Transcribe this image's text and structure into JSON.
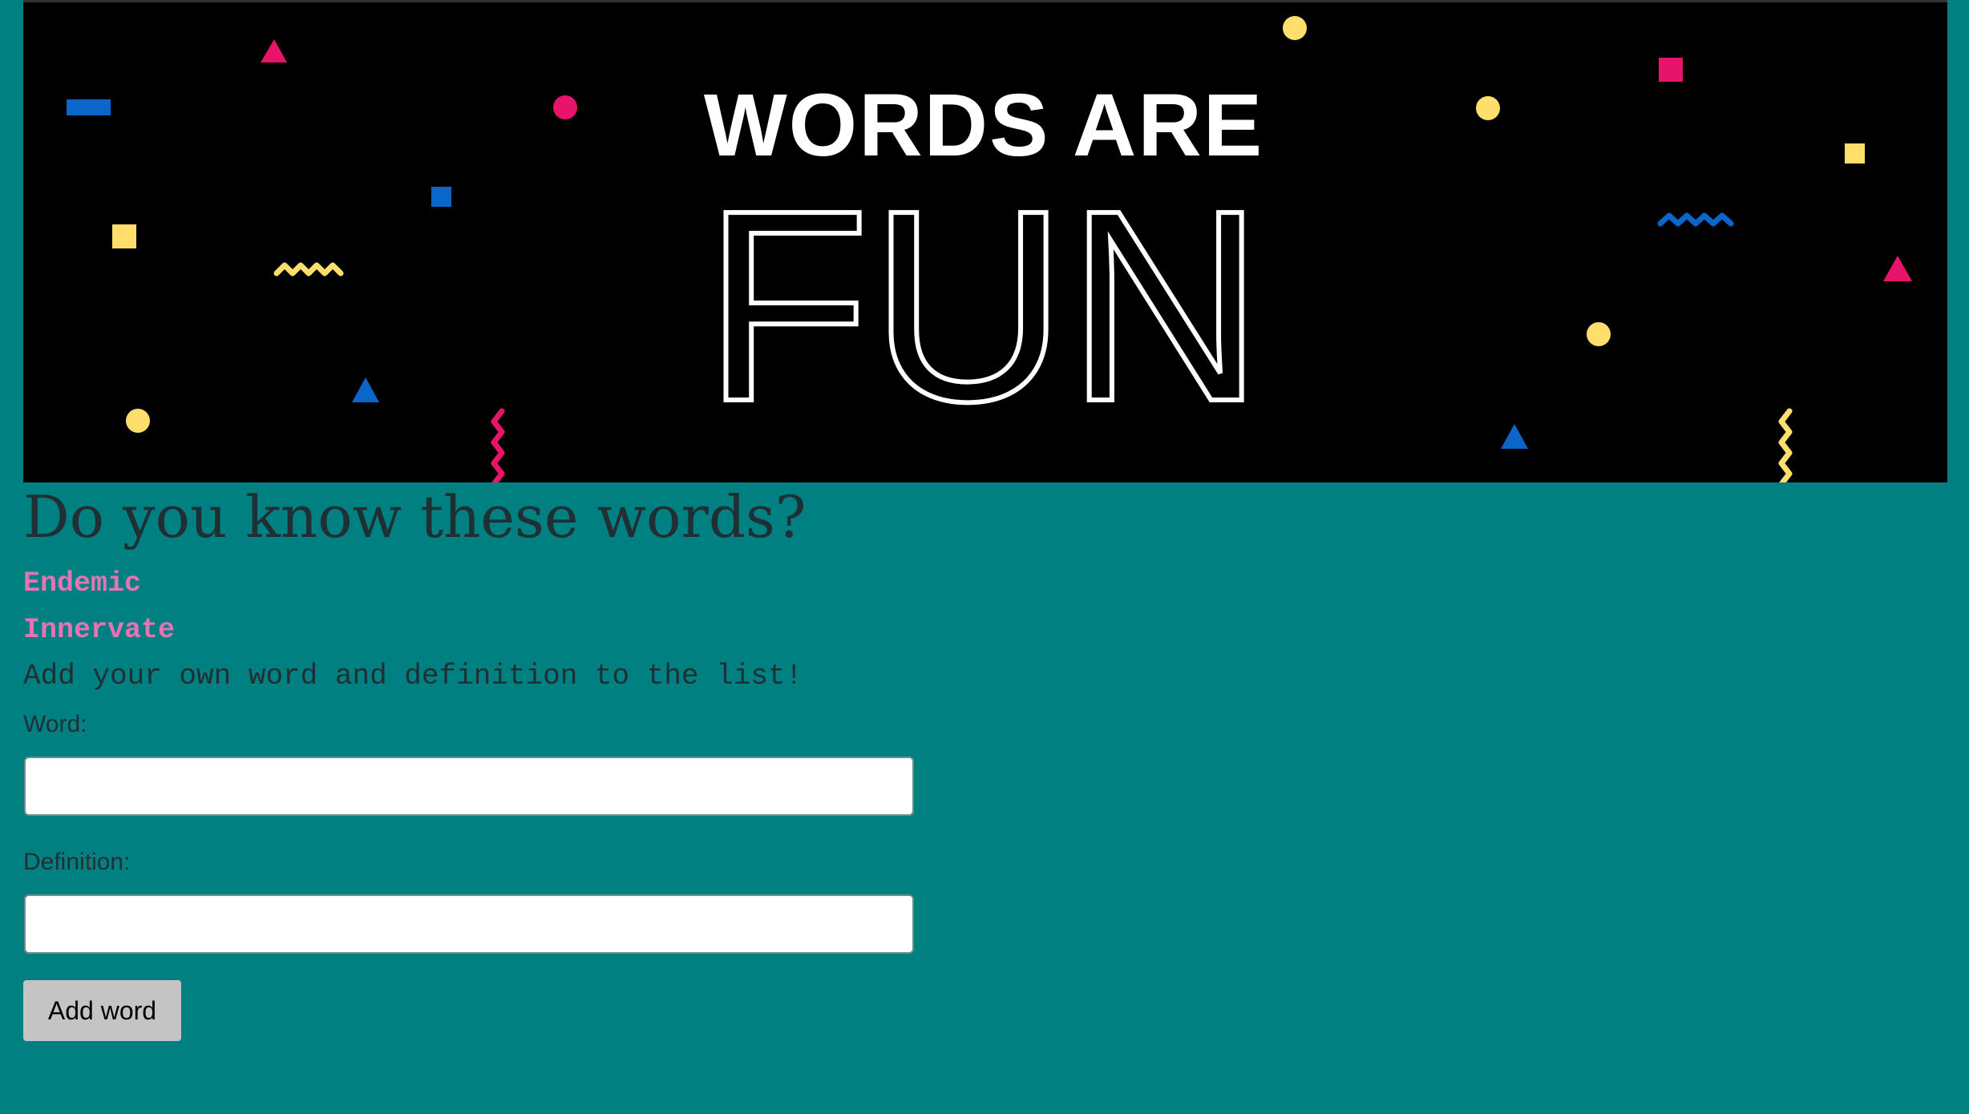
{
  "banner": {
    "line1": "WORDS ARE",
    "line2": "FUN",
    "colors": {
      "background": "#000000",
      "text": "#ffffff",
      "pink": "#e8146c",
      "blue": "#0a66c8",
      "yellow": "#ffde6b"
    }
  },
  "main": {
    "heading": "Do you know these words?",
    "words": [
      "Endemic",
      "Innervate"
    ],
    "prompt": "Add your own word and definition to the list!"
  },
  "form": {
    "word_label": "Word:",
    "word_value": "",
    "definition_label": "Definition:",
    "definition_value": "",
    "submit_label": "Add word"
  },
  "colors": {
    "page_background": "#008080",
    "word_link": "#e574b4",
    "text": "#1f2f33",
    "button": "#c4c4c4"
  }
}
